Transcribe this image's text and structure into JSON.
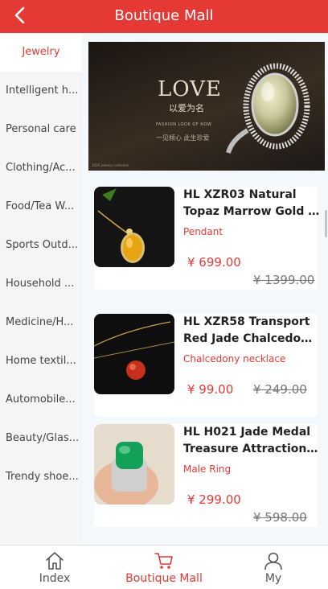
{
  "header": {
    "title": "Boutique Mall"
  },
  "sidebar": {
    "items": [
      {
        "label": "Jewelry",
        "active": true
      },
      {
        "label": "Intelligent h...",
        "active": false
      },
      {
        "label": "Personal care",
        "active": false
      },
      {
        "label": "Clothing/Ac...",
        "active": false
      },
      {
        "label": "Food/Tea W...",
        "active": false
      },
      {
        "label": "Sports Outd...",
        "active": false
      },
      {
        "label": "Household ...",
        "active": false
      },
      {
        "label": "Medicine/H...",
        "active": false
      },
      {
        "label": "Home textil...",
        "active": false
      },
      {
        "label": "Automobile...",
        "active": false
      },
      {
        "label": "Beauty/Glas...",
        "active": false
      },
      {
        "label": "Trendy shoe...",
        "active": false
      }
    ]
  },
  "banner": {
    "love": "LOVE",
    "cn1": "以爱为名",
    "sub": "FASHION LOOK OF NOW",
    "cn2": "一见倾心  此生珍爱",
    "tiny": "2020 jewelry collection"
  },
  "products": [
    {
      "name_line1": "HL XZR03 Natural",
      "name_line2": "Topaz Marrow Gold Pendant",
      "category": "Pendant",
      "price": "¥ 699.00",
      "original_price": "¥ 1399.00"
    },
    {
      "name_line1": "HL XZR58 Transport",
      "name_line2": "Red Jade Chalcedony Necklace",
      "category": "Chalcedony necklace",
      "price": "¥ 99.00",
      "original_price": "¥ 249.00"
    },
    {
      "name_line1": "HL H021 Jade Medal",
      "name_line2": "Treasure Attraction Ring",
      "category": "Male Ring",
      "price": "¥ 299.00",
      "original_price": "¥ 598.00"
    }
  ],
  "tabbar": {
    "items": [
      {
        "label": "Index",
        "icon": "home-icon",
        "active": false
      },
      {
        "label": "Boutique Mall",
        "icon": "cart-icon",
        "active": true
      },
      {
        "label": "My",
        "icon": "user-icon",
        "active": false
      }
    ]
  },
  "colors": {
    "accent": "#e53935",
    "sidebar_bg": "#f5f5f5",
    "content_bg": "#f3f8fd"
  }
}
